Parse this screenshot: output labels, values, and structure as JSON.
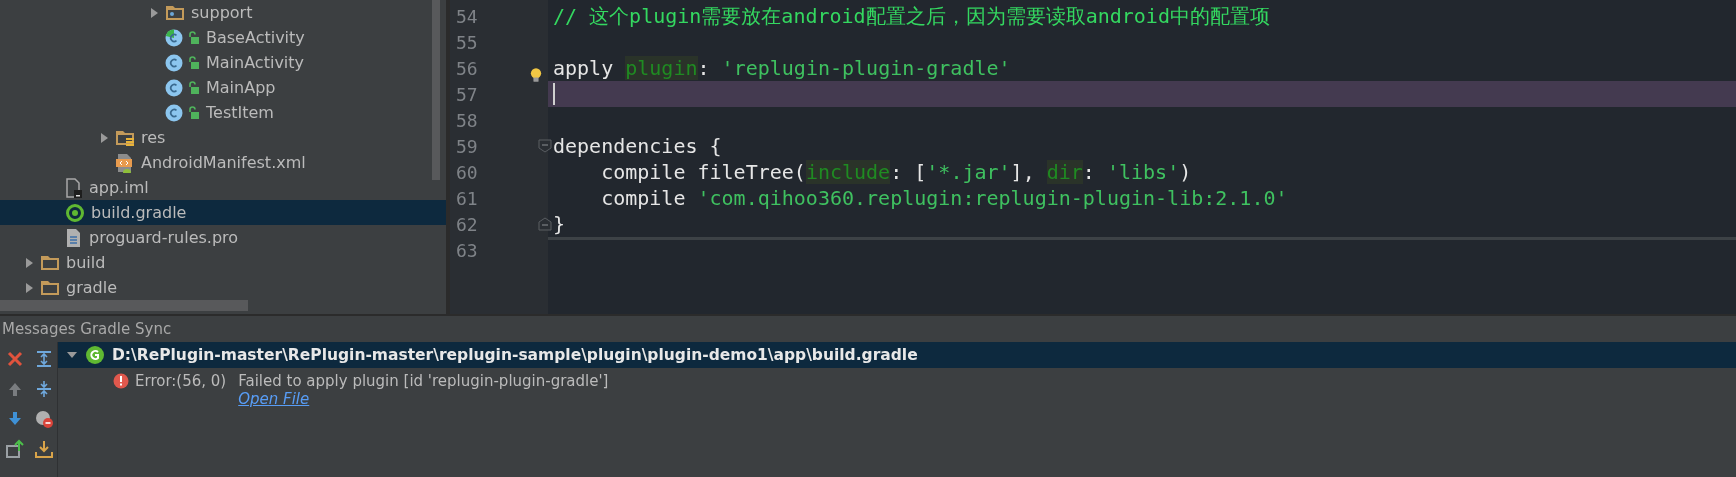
{
  "project_tree": {
    "items": [
      {
        "children": [
          {
            "children": [
              {
                "children": [
                  {
                    "children": [
                      {
                        "children": [
                          {
                            "label": "support",
                            "kind": "package",
                            "expanded": false,
                            "selected": false
                          },
                          {
                            "label": "BaseActivity",
                            "kind": "activity",
                            "selected": false
                          },
                          {
                            "label": "MainActivity",
                            "kind": "class",
                            "selected": false
                          },
                          {
                            "label": "MainApp",
                            "kind": "class",
                            "selected": false
                          },
                          {
                            "label": "TestItem",
                            "kind": "class",
                            "selected": false
                          }
                        ]
                      }
                    ]
                  },
                  {
                    "label": "res",
                    "kind": "resfolder",
                    "expanded": false,
                    "selected": false
                  },
                  {
                    "label": "AndroidManifest.xml",
                    "kind": "manifest",
                    "selected": false
                  }
                ]
              }
            ]
          },
          {
            "label": "app.iml",
            "kind": "iml",
            "selected": false
          },
          {
            "label": "build.gradle",
            "kind": "gradle",
            "selected": true
          },
          {
            "label": "proguard-rules.pro",
            "kind": "text",
            "selected": false
          }
        ]
      },
      {
        "label": "build",
        "kind": "folder",
        "expanded": false,
        "selected": false
      },
      {
        "label": "gradle",
        "kind": "folder",
        "expanded": false,
        "selected": false
      }
    ]
  },
  "editor": {
    "lines": [
      {
        "number": "54",
        "current": false,
        "tokens": [
          {
            "kind": "comment",
            "text": "// 这个plugin需要放在android配置之后，因为需要读取android中的配置项"
          }
        ]
      },
      {
        "number": "55",
        "current": false
      },
      {
        "number": "56",
        "current": false,
        "hint": true,
        "tokens": [
          {
            "kind": "plain",
            "text": "apply "
          },
          {
            "kind": "named",
            "text": "plugin"
          },
          {
            "kind": "plain",
            "text": ": "
          },
          {
            "kind": "string",
            "text": "'replugin-plugin-gradle'"
          }
        ]
      },
      {
        "number": "57",
        "current": true
      },
      {
        "number": "58",
        "current": false
      },
      {
        "number": "59",
        "current": false,
        "fold_start": true,
        "tokens": [
          {
            "kind": "plain",
            "text": "dependencies {"
          }
        ]
      },
      {
        "number": "60",
        "current": false,
        "tokens": [
          {
            "kind": "plain",
            "text": "    compile fileTree("
          },
          {
            "kind": "named",
            "text": "include"
          },
          {
            "kind": "plain",
            "text": ": ["
          },
          {
            "kind": "string",
            "text": "'*.jar'"
          },
          {
            "kind": "plain",
            "text": "], "
          },
          {
            "kind": "named",
            "text": "dir"
          },
          {
            "kind": "plain",
            "text": ": "
          },
          {
            "kind": "string",
            "text": "'libs'"
          },
          {
            "kind": "plain",
            "text": ")"
          }
        ]
      },
      {
        "number": "61",
        "current": false,
        "tokens": [
          {
            "kind": "plain",
            "text": "    compile "
          },
          {
            "kind": "string",
            "text": "'com.qihoo360.replugin:replugin-plugin-lib:2.1.0'"
          }
        ]
      },
      {
        "number": "62",
        "current": false,
        "fold_end": true,
        "tokens": [
          {
            "kind": "plain",
            "text": "}"
          }
        ]
      },
      {
        "number": "63",
        "current": false
      }
    ]
  },
  "messages_panel": {
    "title": "Messages Gradle Sync",
    "file": {
      "path": "D:\\RePlugin-master\\RePlugin-master\\replugin-sample\\plugin\\plugin-demo1\\app\\build.gradle",
      "expanded": true
    },
    "errors": [
      {
        "location": "Error:(56, 0)",
        "message": "Failed to apply plugin [id 'replugin-plugin-gradle']",
        "link": "Open File"
      }
    ]
  }
}
